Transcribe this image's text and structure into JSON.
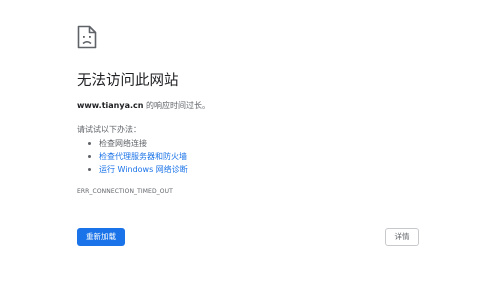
{
  "error_page": {
    "icon": "sad-page-icon",
    "title": "无法访问此网站",
    "host": "www.tianya.cn",
    "host_message": " 的响应时间过长。",
    "suggestions_heading": "请试试以下办法：",
    "suggestions": [
      {
        "label": "检查网络连接",
        "link": false
      },
      {
        "label": "检查代理服务器和防火墙",
        "link": true
      },
      {
        "label": "运行 Windows 网络诊断",
        "link": true
      }
    ],
    "error_code": "ERR_CONNECTION_TIMED_OUT",
    "reload_label": "重新加载",
    "details_label": "详情"
  },
  "colors": {
    "primary_button": "#1a73e8",
    "link": "#1a73e8",
    "text": "#202124",
    "secondary_text": "#5f6368"
  }
}
